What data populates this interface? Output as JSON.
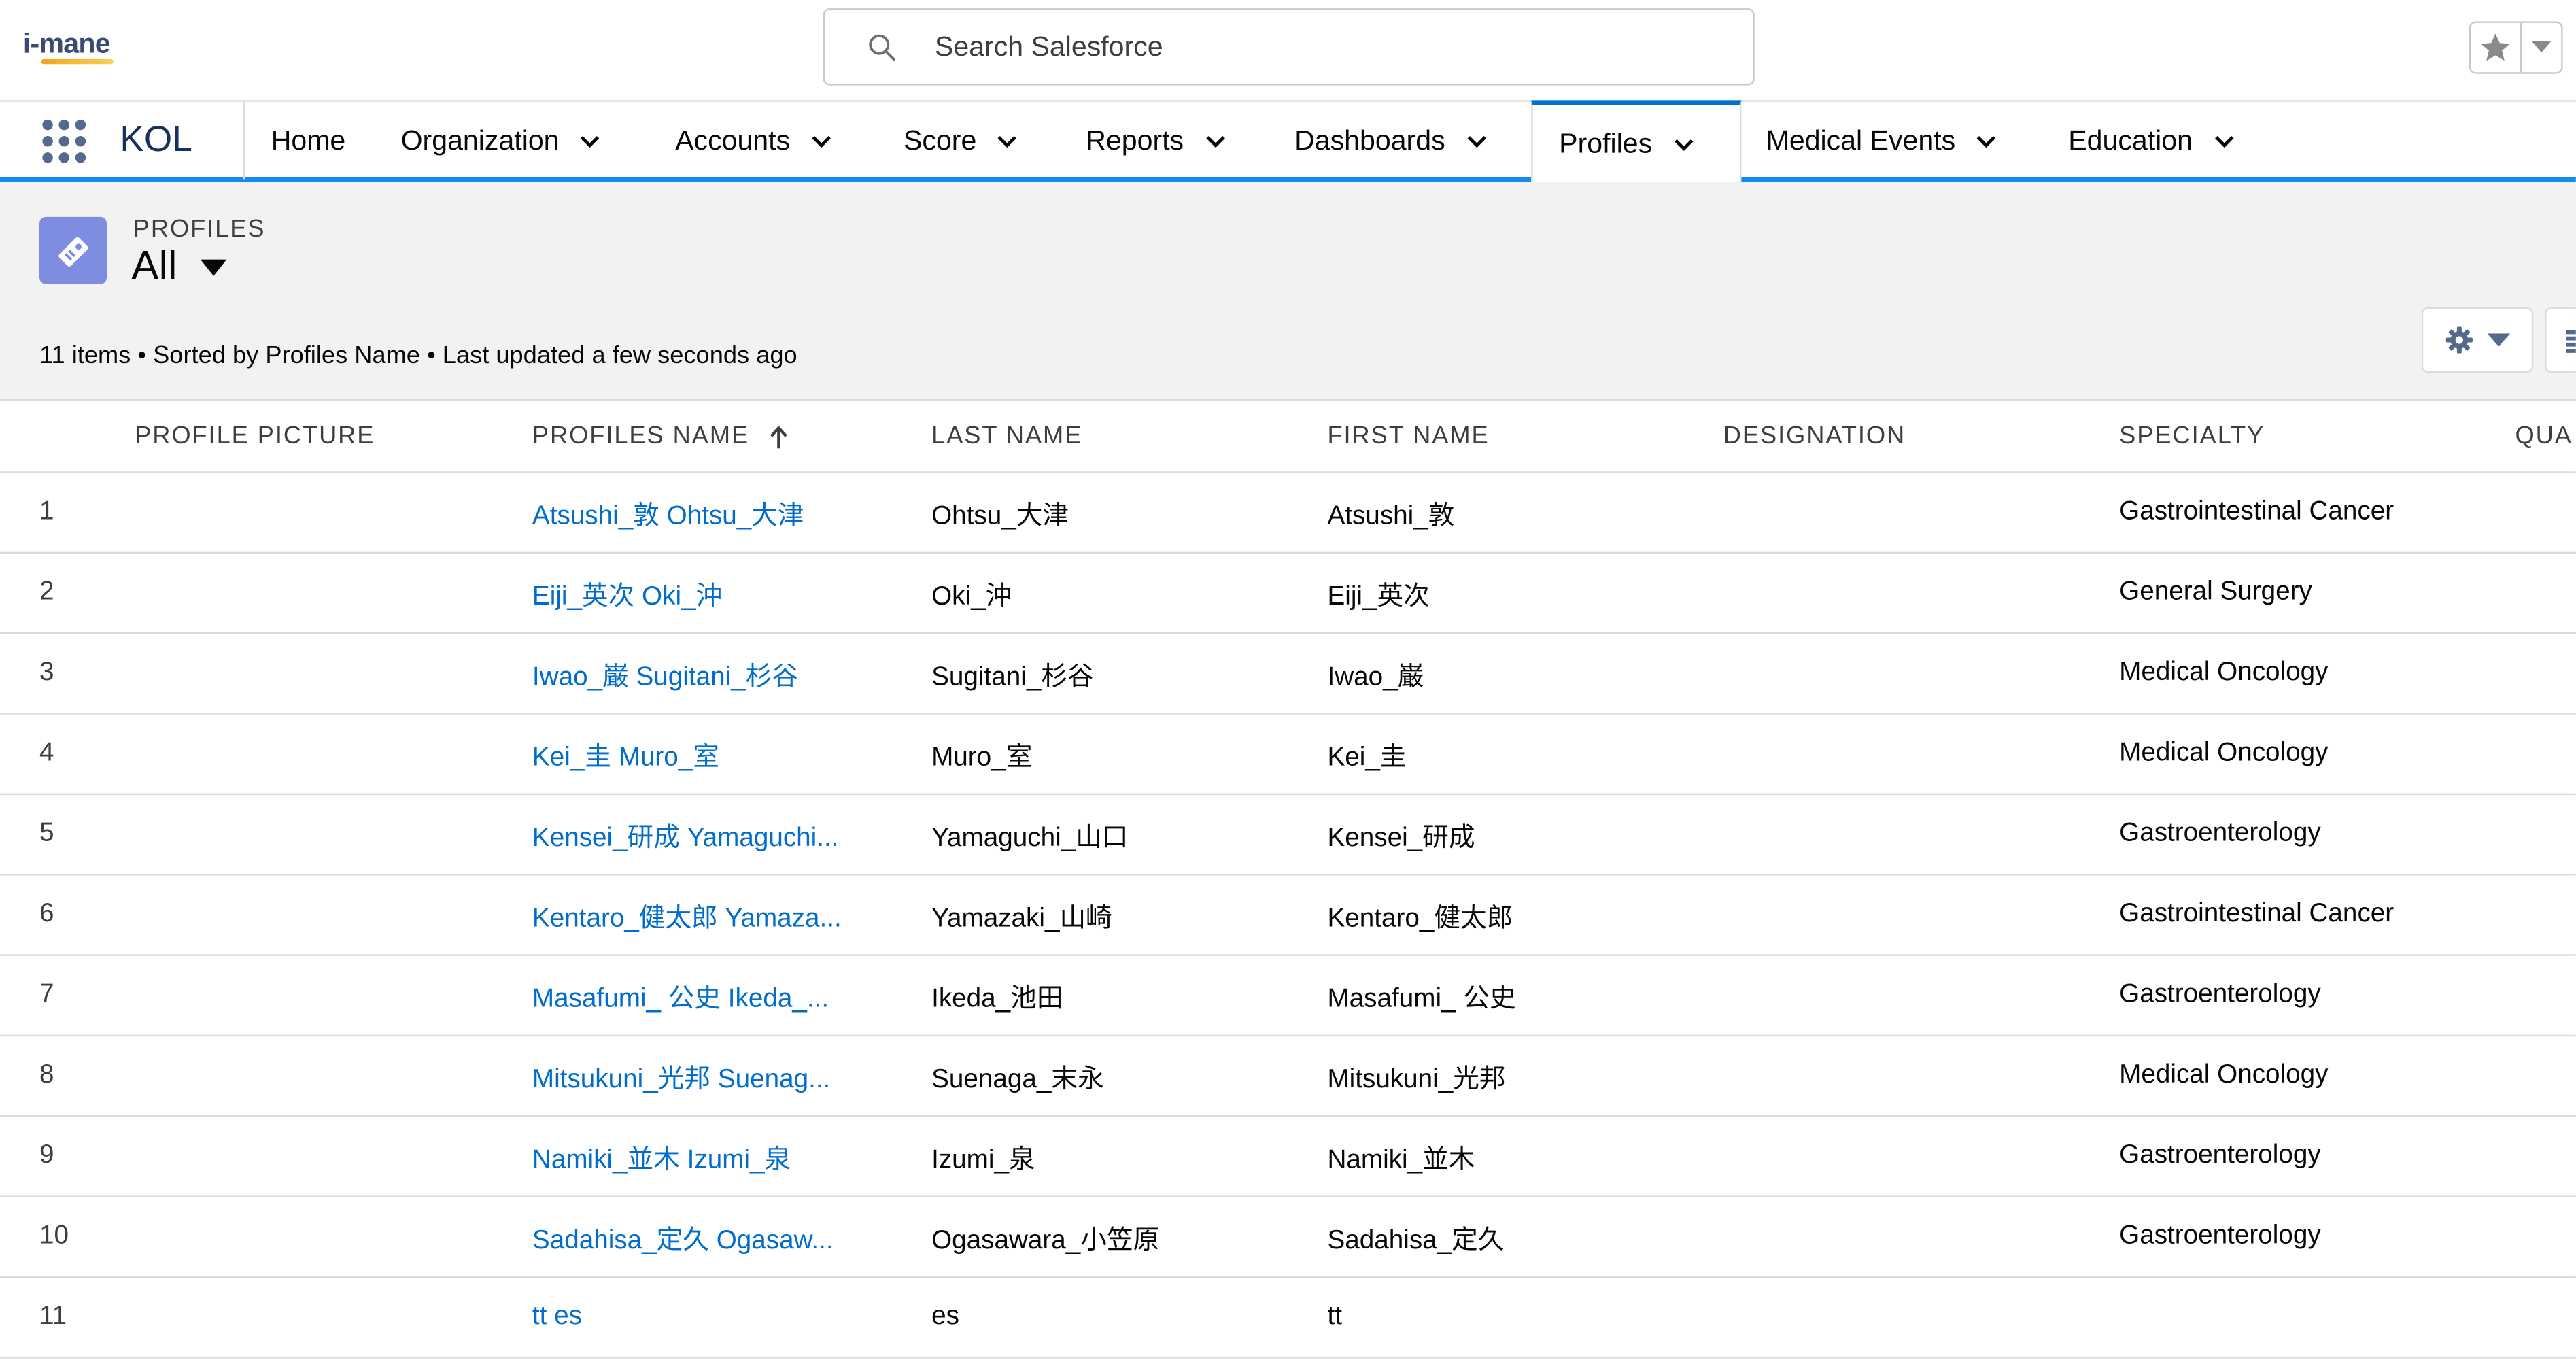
{
  "header": {
    "logo_text": "i-mane",
    "search": {
      "placeholder": "Search Salesforce",
      "value": ""
    }
  },
  "nav": {
    "app_name": "KOL",
    "items": [
      {
        "label": "Home",
        "has_menu": false
      },
      {
        "label": "Organization",
        "has_menu": true
      },
      {
        "label": "Accounts",
        "has_menu": true
      },
      {
        "label": "Score",
        "has_menu": true
      },
      {
        "label": "Reports",
        "has_menu": true
      },
      {
        "label": "Dashboards",
        "has_menu": true
      },
      {
        "label": "Profiles",
        "has_menu": true,
        "active": true
      },
      {
        "label": "Medical Events",
        "has_menu": true
      },
      {
        "label": "Education",
        "has_menu": true
      }
    ]
  },
  "list_header": {
    "object_label": "PROFILES",
    "view_name": "All",
    "info": "11 items • Sorted by Profiles Name • Last updated a few seconds ago"
  },
  "table": {
    "columns": [
      "PROFILE PICTURE",
      "PROFILES NAME",
      "LAST NAME",
      "FIRST NAME",
      "DESIGNATION",
      "SPECIALTY",
      "QUA"
    ],
    "sorted_column": "PROFILES NAME",
    "rows": [
      {
        "num": "1",
        "name": "Atsushi_敦 Ohtsu_大津",
        "last": "Ohtsu_大津",
        "first": "Atsushi_敦",
        "designation": "",
        "specialty": "Gastrointestinal Cancer"
      },
      {
        "num": "2",
        "name": "Eiji_英次 Oki_沖",
        "last": "Oki_沖",
        "first": "Eiji_英次",
        "designation": "",
        "specialty": "General Surgery"
      },
      {
        "num": "3",
        "name": "Iwao_巌 Sugitani_杉谷",
        "last": "Sugitani_杉谷",
        "first": "Iwao_巌",
        "designation": "",
        "specialty": "Medical Oncology"
      },
      {
        "num": "4",
        "name": "Kei_圭 Muro_室",
        "last": "Muro_室",
        "first": "Kei_圭",
        "designation": "",
        "specialty": "Medical Oncology"
      },
      {
        "num": "5",
        "name": "Kensei_研成 Yamaguchi...",
        "last": "Yamaguchi_山口",
        "first": "Kensei_研成",
        "designation": "",
        "specialty": "Gastroenterology"
      },
      {
        "num": "6",
        "name": "Kentaro_健太郎 Yamaza...",
        "last": "Yamazaki_山崎",
        "first": "Kentaro_健太郎",
        "designation": "",
        "specialty": "Gastrointestinal Cancer"
      },
      {
        "num": "7",
        "name": "Masafumi_ 公史 Ikeda_...",
        "last": "Ikeda_池田",
        "first": "Masafumi_ 公史",
        "designation": "",
        "specialty": "Gastroenterology"
      },
      {
        "num": "8",
        "name": "Mitsukuni_光邦 Suenag...",
        "last": "Suenaga_末永",
        "first": "Mitsukuni_光邦",
        "designation": "",
        "specialty": "Medical Oncology"
      },
      {
        "num": "9",
        "name": "Namiki_並木 Izumi_泉",
        "last": "Izumi_泉",
        "first": "Namiki_並木",
        "designation": "",
        "specialty": "Gastroenterology"
      },
      {
        "num": "10",
        "name": "Sadahisa_定久 Ogasaw...",
        "last": "Ogasawara_小笠原",
        "first": "Sadahisa_定久",
        "designation": "",
        "specialty": "Gastroenterology"
      },
      {
        "num": "11",
        "name": "tt es",
        "last": "es",
        "first": "tt",
        "designation": "",
        "specialty": ""
      }
    ]
  },
  "colors": {
    "brand_blue": "#1589ee",
    "link_blue": "#006dcc",
    "object_icon": "#7f8de1",
    "header_bg": "#f3f2f2"
  },
  "icons": {
    "search": "search-icon",
    "favorite": "star-icon",
    "app_launcher": "waffle-grid-icon",
    "object": "profile-tag-icon",
    "settings": "gear-icon"
  }
}
